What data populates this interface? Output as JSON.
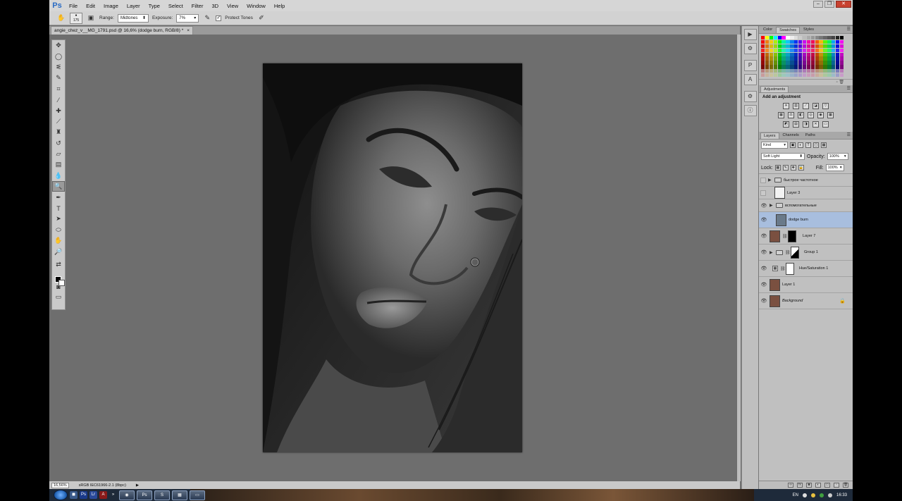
{
  "app": {
    "logo": "Ps"
  },
  "menu": [
    "File",
    "Edit",
    "Image",
    "Layer",
    "Type",
    "Select",
    "Filter",
    "3D",
    "View",
    "Window",
    "Help"
  ],
  "options": {
    "brush_size": "175",
    "range_label": "Range:",
    "range_value": "Midtones",
    "exposure_label": "Exposure:",
    "exposure_value": "7%",
    "protect_tones_label": "Protect Tones",
    "protect_tones_checked": true
  },
  "document": {
    "tab_title": "angie_chez_v__MG_1791.psd @ 16,6% (dodge burn, RGB/8) *",
    "close": "×"
  },
  "status": {
    "zoom": "16,56%",
    "profile": "sRGB IEC61966-2.1 (8bpc)"
  },
  "panels": {
    "color_tabs": [
      "Color",
      "Swatches",
      "Styles"
    ],
    "active_color_tab": "Swatches",
    "adjustments_tab": "Adjustments",
    "adjustments_title": "Add an adjustment",
    "layers_tabs": [
      "Layers",
      "Channels",
      "Paths"
    ],
    "kind_label": "Kind",
    "blend_mode": "Soft Light",
    "opacity_label": "Opacity:",
    "opacity_value": "100%",
    "lock_label": "Lock:",
    "fill_label": "Fill:",
    "fill_value": "100%"
  },
  "layers": [
    {
      "name": "быстрое частотное",
      "type": "group",
      "visible": false
    },
    {
      "name": "Layer 3",
      "type": "layer",
      "visible": false
    },
    {
      "name": "вспомогательные",
      "type": "group",
      "visible": true
    },
    {
      "name": "dodge burn",
      "type": "layer",
      "visible": true,
      "selected": true
    },
    {
      "name": "Layer 7",
      "type": "masked",
      "visible": true
    },
    {
      "name": "Group 1",
      "type": "group-masked",
      "visible": true
    },
    {
      "name": "Hue/Saturation 1",
      "type": "adjustment",
      "visible": true
    },
    {
      "name": "Layer 1",
      "type": "layer",
      "visible": true
    },
    {
      "name": "Background",
      "type": "background",
      "visible": true,
      "locked": true
    }
  ],
  "taskbar": {
    "lang": "EN",
    "time": "16:33"
  },
  "colors": {
    "ps_blue": "#2b6cc4",
    "selected_layer": "#a8bede",
    "workspace": "#6e6e6e"
  }
}
